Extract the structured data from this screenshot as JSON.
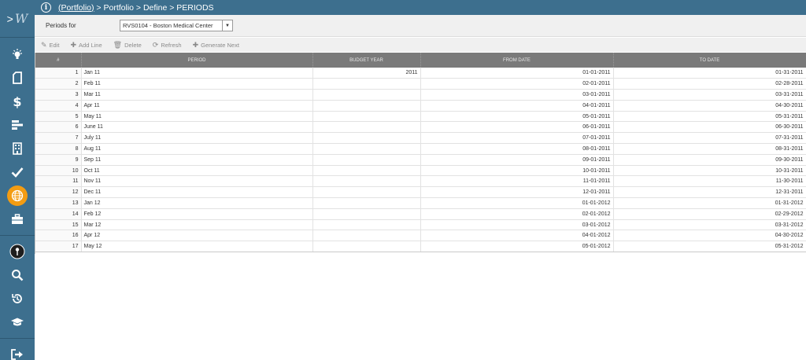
{
  "sidebar": {
    "logo": "W",
    "expand": ">"
  },
  "breadcrumb": {
    "info_icon": "i",
    "link": "(Portfolio)",
    "rest": " > Portfolio > Define > PERIODS"
  },
  "filter": {
    "label": "Periods for",
    "selected": "RVS0104 - Boston Medical Center"
  },
  "toolbar": {
    "edit": "Edit",
    "add_line": "Add Line",
    "delete": "Delete",
    "refresh": "Refresh",
    "generate_next": "Generate Next"
  },
  "table": {
    "columns": [
      "#",
      "PERIOD",
      "BUDGET YEAR",
      "FROM DATE",
      "TO DATE"
    ],
    "rows": [
      [
        "1",
        "Jan 11",
        "2011",
        "01-01-2011",
        "01-31-2011"
      ],
      [
        "2",
        "Feb 11",
        "",
        "02-01-2011",
        "02-28-2011"
      ],
      [
        "3",
        "Mar 11",
        "",
        "03-01-2011",
        "03-31-2011"
      ],
      [
        "4",
        "Apr 11",
        "",
        "04-01-2011",
        "04-30-2011"
      ],
      [
        "5",
        "May 11",
        "",
        "05-01-2011",
        "05-31-2011"
      ],
      [
        "6",
        "June 11",
        "",
        "06-01-2011",
        "06-30-2011"
      ],
      [
        "7",
        "July 11",
        "",
        "07-01-2011",
        "07-31-2011"
      ],
      [
        "8",
        "Aug 11",
        "",
        "08-01-2011",
        "08-31-2011"
      ],
      [
        "9",
        "Sep 11",
        "",
        "09-01-2011",
        "09-30-2011"
      ],
      [
        "10",
        "Oct 11",
        "",
        "10-01-2011",
        "10-31-2011"
      ],
      [
        "11",
        "Nov 11",
        "",
        "11-01-2011",
        "11-30-2011"
      ],
      [
        "12",
        "Dec 11",
        "",
        "12-01-2011",
        "12-31-2011"
      ],
      [
        "13",
        "Jan 12",
        "",
        "01-01-2012",
        "01-31-2012"
      ],
      [
        "14",
        "Feb 12",
        "",
        "02-01-2012",
        "02-29-2012"
      ],
      [
        "15",
        "Mar 12",
        "",
        "03-01-2012",
        "03-31-2012"
      ],
      [
        "16",
        "Apr 12",
        "",
        "04-01-2012",
        "04-30-2012"
      ],
      [
        "17",
        "May 12",
        "",
        "05-01-2012",
        "05-31-2012"
      ]
    ]
  },
  "colors": {
    "sidebar": "#3d6f8e",
    "header": "#7a7a7a",
    "accent": "#f39c12"
  }
}
